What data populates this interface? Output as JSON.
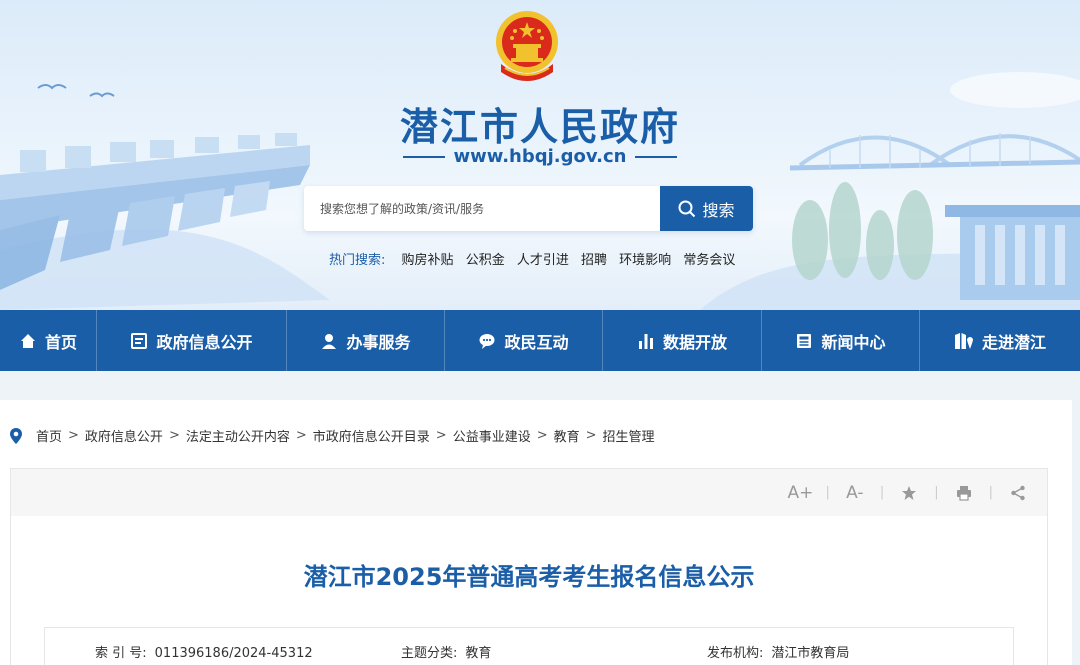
{
  "header": {
    "site_name": "潜江市人民政府",
    "site_url": "www.hbqj.gov.cn",
    "emblem_icon": "national-emblem"
  },
  "search": {
    "placeholder": "搜索您想了解的政策/资讯/服务",
    "button_label": "搜索",
    "hot_label": "热门搜索:",
    "hot_items": [
      "购房补贴",
      "公积金",
      "人才引进",
      "招聘",
      "环境影响",
      "常务会议"
    ]
  },
  "nav": {
    "items": [
      {
        "label": "首页",
        "icon": "home-icon"
      },
      {
        "label": "政府信息公开",
        "icon": "document-icon"
      },
      {
        "label": "办事服务",
        "icon": "user-icon"
      },
      {
        "label": "政民互动",
        "icon": "chat-icon"
      },
      {
        "label": "数据开放",
        "icon": "bar-chart-icon"
      },
      {
        "label": "新闻中心",
        "icon": "news-icon"
      },
      {
        "label": "走进潜江",
        "icon": "map-icon"
      }
    ]
  },
  "breadcrumb": [
    "首页",
    "政府信息公开",
    "法定主动公开内容",
    "市政府信息公开目录",
    "公益事业建设",
    "教育",
    "招生管理"
  ],
  "toolbar": {
    "font_increase": "A+",
    "font_decrease": "A-"
  },
  "article": {
    "title": "潜江市2025年普通高考考生报名信息公示",
    "meta": {
      "index_label": "索 引 号:",
      "index_value": "011396186/2024-45312",
      "topic_label": "主题分类:",
      "topic_value": "教育",
      "publisher_label": "发布机构:",
      "publisher_value": "潜江市教育局"
    }
  },
  "colors": {
    "brand_blue": "#1b5ea8",
    "emblem_red": "#d92a1c",
    "emblem_gold": "#f2c12e"
  }
}
